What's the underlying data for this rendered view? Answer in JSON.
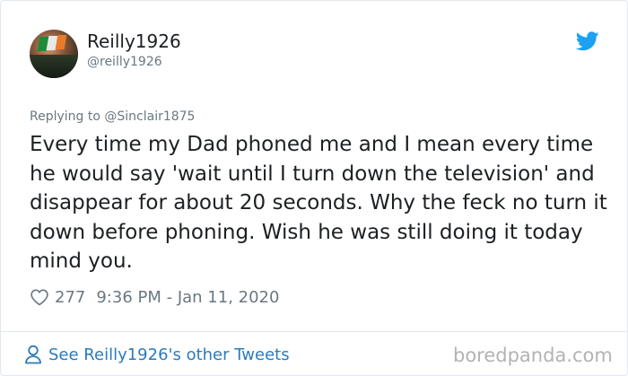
{
  "author": {
    "display_name": "Reilly1926",
    "handle": "@reilly1926",
    "avatar_icon": "avatar-image"
  },
  "reply_context": "Replying to @Sinclair1875",
  "tweet_text": "Every time my Dad phoned me and I mean every time he would say 'wait until I turn down the television' and disappear for about 20 seconds. Why the feck no turn it down before phoning. Wish he was still doing it today mind you.",
  "meta": {
    "like_count": "277",
    "timestamp": "9:36 PM - Jan 11, 2020"
  },
  "footer": {
    "see_more_label": "See Reilly1926's other Tweets"
  },
  "watermark": "boredpanda.com",
  "icons": {
    "brand": "twitter-bird-icon",
    "like": "heart-icon",
    "profile": "person-icon"
  },
  "colors": {
    "twitter_blue": "#1da1f2",
    "link_blue": "#2b7bb9",
    "secondary_text": "#697882",
    "primary_text": "#1c2022",
    "border": "#e1e8ed"
  }
}
